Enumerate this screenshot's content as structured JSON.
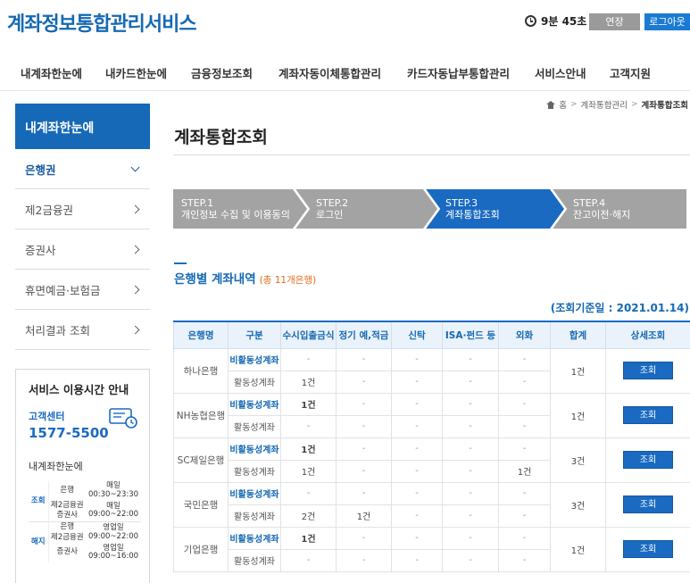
{
  "header": {
    "brand": "계좌정보통합관리서비스",
    "timer": "9분 45초",
    "extend_label": "연장",
    "logout_label": "로그아웃"
  },
  "gnb": [
    "내계좌한눈에",
    "내카드한눈에",
    "금융정보조회",
    "계좌자동이체통합관리",
    "카드자동납부통합관리",
    "서비스안내",
    "고객지원"
  ],
  "breadcrumb": [
    "홈",
    "계좌통합관리",
    "계좌통합조회"
  ],
  "sidebar": {
    "title": "내계좌한눈에",
    "items": [
      "은행권",
      "제2금융권",
      "증권사",
      "휴면예금·보험금",
      "처리결과 조회"
    ]
  },
  "service_info": {
    "title": "서비스 이용시간 안내",
    "cs_label": "고객센터",
    "cs_phone": "1577-5500",
    "subtitle": "내계좌한눈에",
    "hours": [
      {
        "group": "조회",
        "bank": "은행",
        "time": "매일 00:30~23:30"
      },
      {
        "group": "",
        "bank": "제2금융권",
        "time": "매일 09:00~22:00"
      },
      {
        "group": "",
        "bank": "증권사",
        "time": ""
      },
      {
        "group": "해지",
        "bank": "은행",
        "time": "영업일 09:00~22:00"
      },
      {
        "group": "",
        "bank": "제2금융권",
        "time": ""
      },
      {
        "group": "",
        "bank": "증권사",
        "time": "영업일 09:00~16:00"
      }
    ]
  },
  "main": {
    "page_title": "계좌통합조회",
    "steps": [
      {
        "step": "STEP.1",
        "label": "개인정보 수집 및 이용동의"
      },
      {
        "step": "STEP.2",
        "label": "로그인"
      },
      {
        "step": "STEP.3",
        "label": "계좌통합조회"
      },
      {
        "step": "STEP.4",
        "label": "잔고이전·해지"
      }
    ],
    "section_title": "은행별 계좌내역",
    "section_count": "(총 11개은행)",
    "ref_date": "(조회기준일 : 2021.01.14)"
  },
  "table": {
    "headers": [
      "은행명",
      "구분",
      "수시입출금식",
      "정기 예,적금",
      "신탁",
      "ISA·펀드 등",
      "외화",
      "합계",
      "상세조회"
    ],
    "view_label": "조회",
    "banks": [
      {
        "name": "하나은행",
        "total": "1건",
        "inactive": [
          "-",
          "-",
          "-",
          "-",
          "-"
        ],
        "active": [
          "1건",
          "-",
          "-",
          "-",
          "-"
        ]
      },
      {
        "name": "NH농협은행",
        "total": "1건",
        "inactive": [
          "1건",
          "-",
          "-",
          "-",
          "-"
        ],
        "active": [
          "-",
          "-",
          "-",
          "-",
          "-"
        ]
      },
      {
        "name": "SC제일은행",
        "total": "3건",
        "inactive": [
          "1건",
          "-",
          "-",
          "-",
          "-"
        ],
        "active": [
          "1건",
          "-",
          "-",
          "-",
          "1건"
        ]
      },
      {
        "name": "국민은행",
        "total": "3건",
        "inactive": [
          "-",
          "-",
          "-",
          "-",
          "-"
        ],
        "active": [
          "2건",
          "1건",
          "-",
          "-",
          "-"
        ]
      },
      {
        "name": "기업은행",
        "total": "1건",
        "inactive": [
          "1건",
          "-",
          "-",
          "-",
          "-"
        ],
        "active": [
          "-",
          "-",
          "-",
          "-",
          "-"
        ]
      }
    ],
    "kind_inactive": "비활동성계좌",
    "kind_active": "활동성계좌"
  },
  "colors": {
    "brand": "#1569b3",
    "step_active": "#1a6ac2",
    "step_inactive": "#a3a3a3"
  },
  "icons": [
    "clock-icon",
    "home-icon",
    "chevron-down-icon",
    "chevron-right-icon",
    "customer-center-icon"
  ]
}
